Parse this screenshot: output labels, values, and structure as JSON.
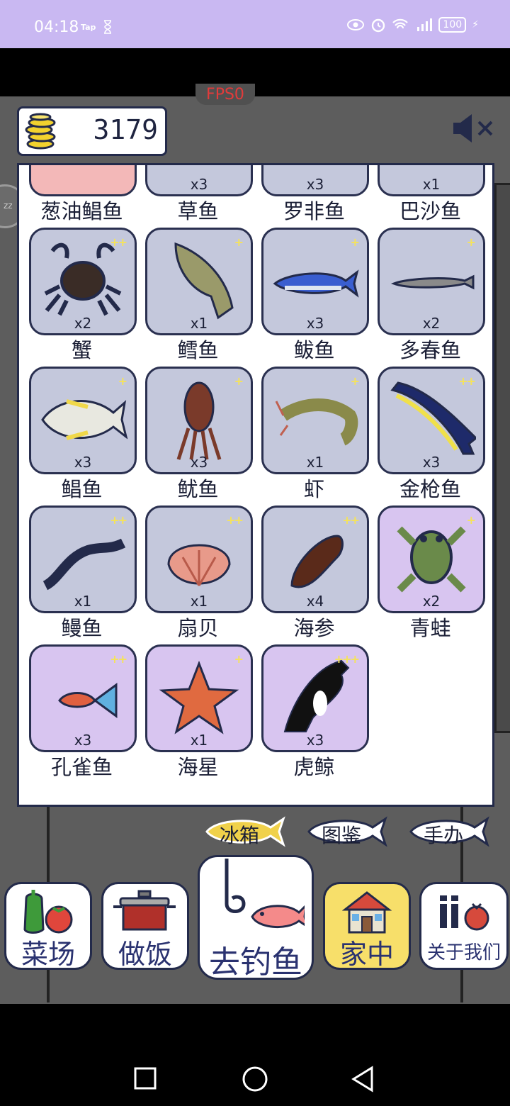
{
  "status_bar": {
    "time": "04:18",
    "tap_label": "Tap",
    "battery": "100"
  },
  "fps_label": "FPS0",
  "coins": {
    "value": "3179"
  },
  "inventory": [
    {
      "name": "葱油鲳鱼",
      "qty": "",
      "stars": "",
      "bg": "pink",
      "icon": "fried-pomfret"
    },
    {
      "name": "草鱼",
      "qty": "x3",
      "stars": "",
      "bg": "gray",
      "icon": "grass-carp"
    },
    {
      "name": "罗非鱼",
      "qty": "x3",
      "stars": "",
      "bg": "gray",
      "icon": "tilapia"
    },
    {
      "name": "巴沙鱼",
      "qty": "x1",
      "stars": "",
      "bg": "gray",
      "icon": "basa-fish"
    },
    {
      "name": "蟹",
      "qty": "x2",
      "stars": "++",
      "bg": "gray",
      "icon": "crab"
    },
    {
      "name": "鳕鱼",
      "qty": "x1",
      "stars": "+",
      "bg": "gray",
      "icon": "cod"
    },
    {
      "name": "鲅鱼",
      "qty": "x3",
      "stars": "+",
      "bg": "gray",
      "icon": "mackerel"
    },
    {
      "name": "多春鱼",
      "qty": "x2",
      "stars": "+",
      "bg": "gray",
      "icon": "capelin"
    },
    {
      "name": "鲳鱼",
      "qty": "x3",
      "stars": "+",
      "bg": "gray",
      "icon": "pomfret"
    },
    {
      "name": "鱿鱼",
      "qty": "x3",
      "stars": "+",
      "bg": "gray",
      "icon": "squid"
    },
    {
      "name": "虾",
      "qty": "x1",
      "stars": "+",
      "bg": "gray",
      "icon": "shrimp"
    },
    {
      "name": "金枪鱼",
      "qty": "x3",
      "stars": "++",
      "bg": "gray",
      "icon": "tuna"
    },
    {
      "name": "鳗鱼",
      "qty": "x1",
      "stars": "++",
      "bg": "gray",
      "icon": "eel"
    },
    {
      "name": "扇贝",
      "qty": "x1",
      "stars": "++",
      "bg": "gray",
      "icon": "scallop"
    },
    {
      "name": "海参",
      "qty": "x4",
      "stars": "++",
      "bg": "gray",
      "icon": "sea-cucumber"
    },
    {
      "name": "青蛙",
      "qty": "x2",
      "stars": "+",
      "bg": "purple",
      "icon": "frog"
    },
    {
      "name": "孔雀鱼",
      "qty": "x3",
      "stars": "++",
      "bg": "purple",
      "icon": "guppy"
    },
    {
      "name": "海星",
      "qty": "x1",
      "stars": "+",
      "bg": "purple",
      "icon": "starfish"
    },
    {
      "name": "虎鲸",
      "qty": "x3",
      "stars": "+++",
      "bg": "purple",
      "icon": "orca"
    }
  ],
  "tabs": {
    "fridge": "冰箱",
    "guide": "图鉴",
    "figures": "手办"
  },
  "nav": {
    "market": "菜场",
    "cook": "做饭",
    "fishing": "去钓鱼",
    "home": "家中",
    "about": "关于我们"
  }
}
